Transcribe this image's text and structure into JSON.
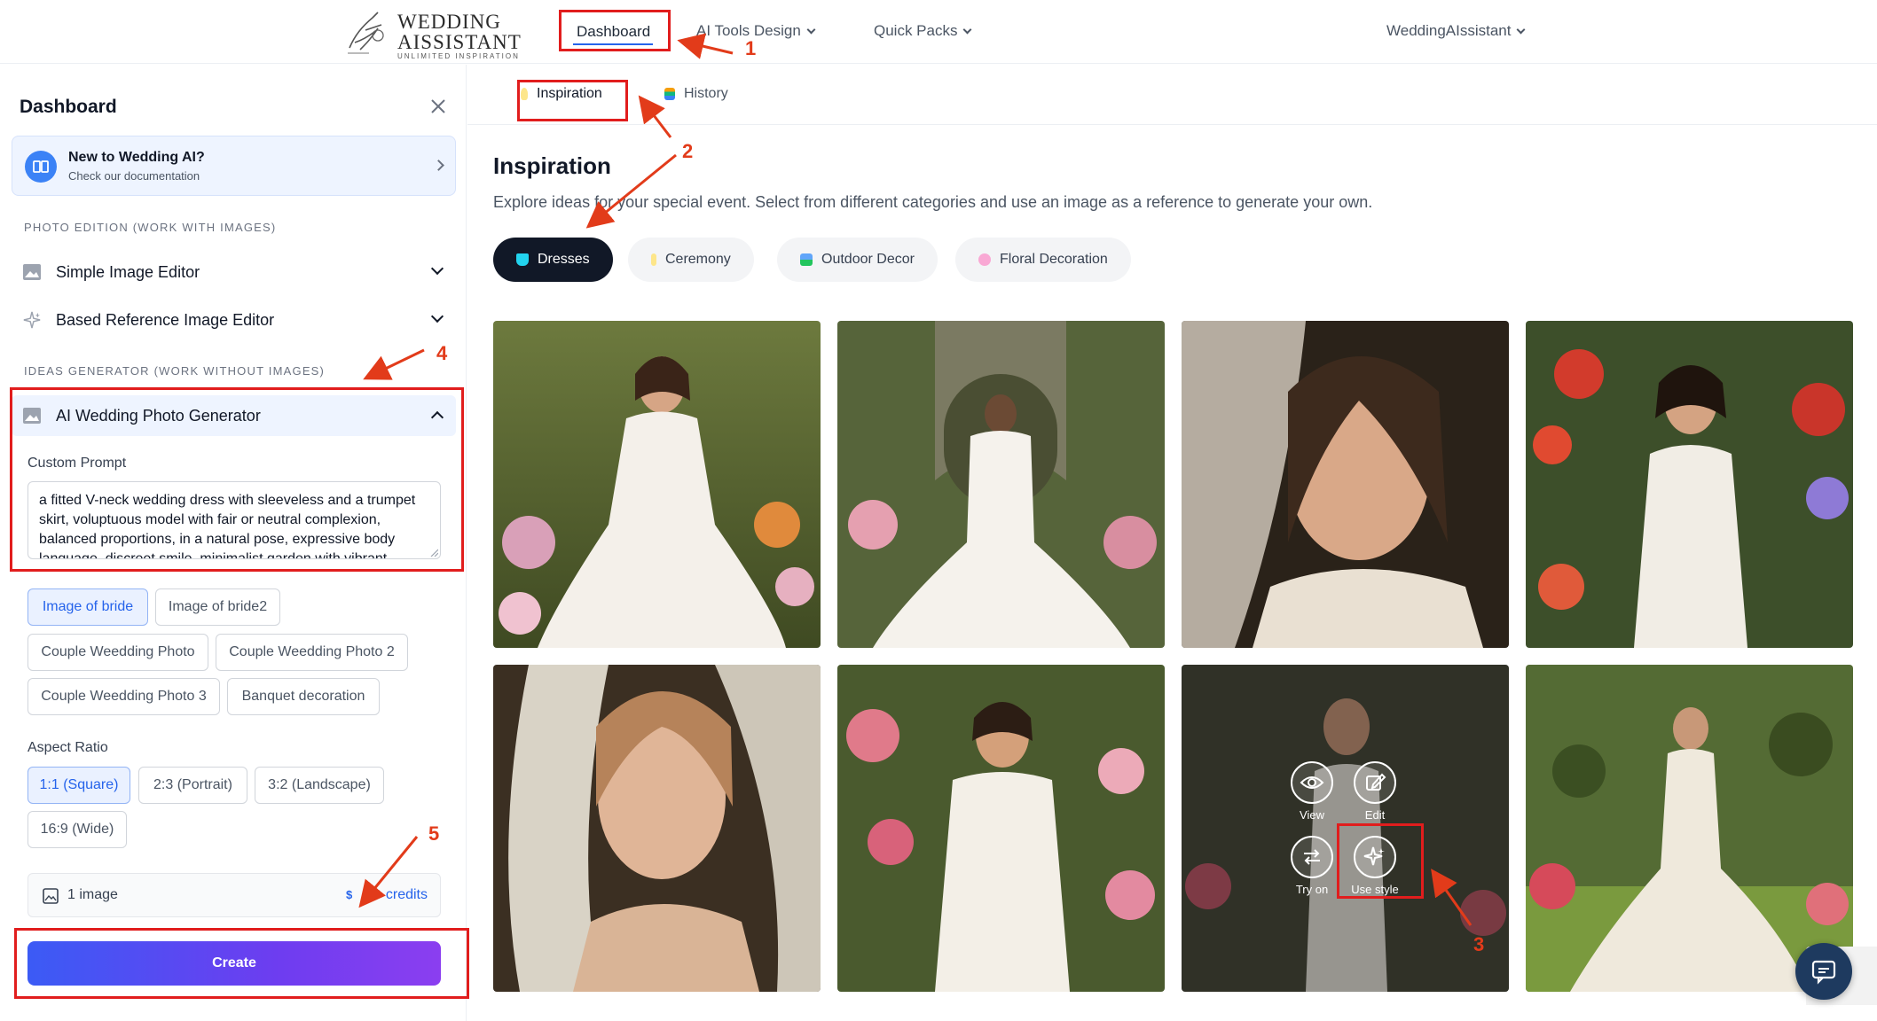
{
  "topnav": {
    "logo_line1": "WEDDING",
    "logo_line2": "AISSISTANT",
    "logo_tagline": "UNLIMITED INSPIRATION",
    "dashboard": "Dashboard",
    "ai_tools": "AI Tools Design",
    "quick_packs": "Quick Packs",
    "account": "WeddingAIssistant"
  },
  "sidebar": {
    "title": "Dashboard",
    "doc_title": "New to Wedding AI?",
    "doc_sub": "Check our documentation",
    "section_photo": "PHOTO EDITION (WORK WITH IMAGES)",
    "simple_editor": "Simple Image Editor",
    "reference_editor": "Based Reference Image Editor",
    "section_ideas": "IDEAS GENERATOR (WORK WITHOUT IMAGES)",
    "generator": "AI Wedding Photo Generator",
    "custom_prompt_label": "Custom Prompt",
    "custom_prompt_value": "a fitted V-neck wedding dress with sleeveless and a trumpet skirt, voluptuous model with fair or neutral complexion, balanced proportions, in a natural pose, expressive body language, discreet smile, minimalist garden with vibrant",
    "presets": [
      "Image of bride",
      "Image of bride2",
      "Couple Weedding Photo",
      "Couple Weedding Photo 2",
      "Couple Weedding Photo 3",
      "Banquet decoration"
    ],
    "aspect_label": "Aspect Ratio",
    "aspects": [
      "1:1 (Square)",
      "2:3 (Portrait)",
      "3:2 (Landscape)",
      "16:9 (Wide)"
    ],
    "image_count": "1 image",
    "credits_icon": "$",
    "credits": "credits",
    "create": "Create"
  },
  "main": {
    "tab_inspiration": "Inspiration",
    "tab_history": "History",
    "heading": "Inspiration",
    "subtitle": "Explore ideas for your special event. Select from different categories and use an image as a reference to generate your own.",
    "categories": [
      "Dresses",
      "Ceremony",
      "Outdoor Decor",
      "Floral Decoration"
    ],
    "overlay": {
      "view": "View",
      "edit": "Edit",
      "try_on": "Try on",
      "use_style": "Use style"
    }
  },
  "annotations": [
    "1",
    "2",
    "3",
    "4",
    "5"
  ],
  "colors": {
    "accent": "#2563eb",
    "annotation": "#e11d1d",
    "create_start": "#3b5bf5",
    "create_end": "#8b3ef0"
  }
}
